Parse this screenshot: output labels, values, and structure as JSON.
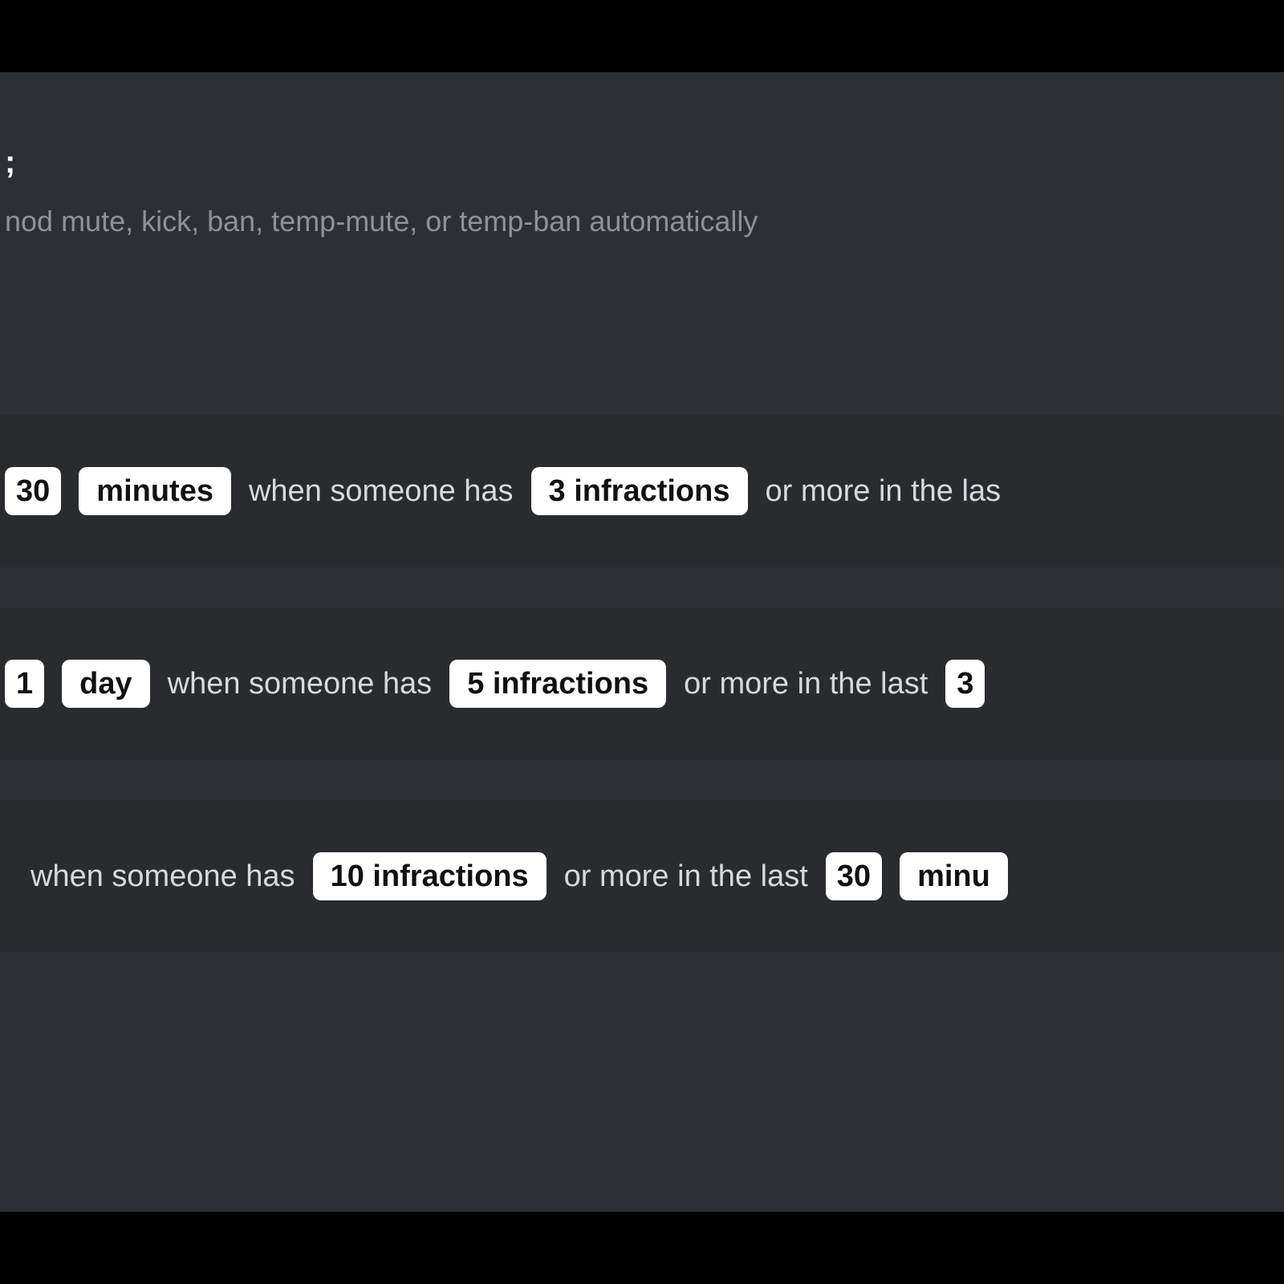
{
  "header": {
    "title_fragment": ";",
    "description_fragment": "nod mute, kick, ban, temp-mute, or temp-ban automatically"
  },
  "phrases": {
    "when_someone_has": "when someone has",
    "or_more_in_the_last": "or more in the last"
  },
  "rules": [
    {
      "duration_amount": "30",
      "duration_unit": "minutes",
      "infractions_label": "3 infractions",
      "tail_text": "or more in the las"
    },
    {
      "duration_amount": "1",
      "duration_unit": "day",
      "infractions_label": "5 infractions",
      "window_amount_fragment": "3"
    },
    {
      "infractions_label": "10 infractions",
      "window_amount": "30",
      "window_unit_fragment": "minu"
    }
  ]
}
